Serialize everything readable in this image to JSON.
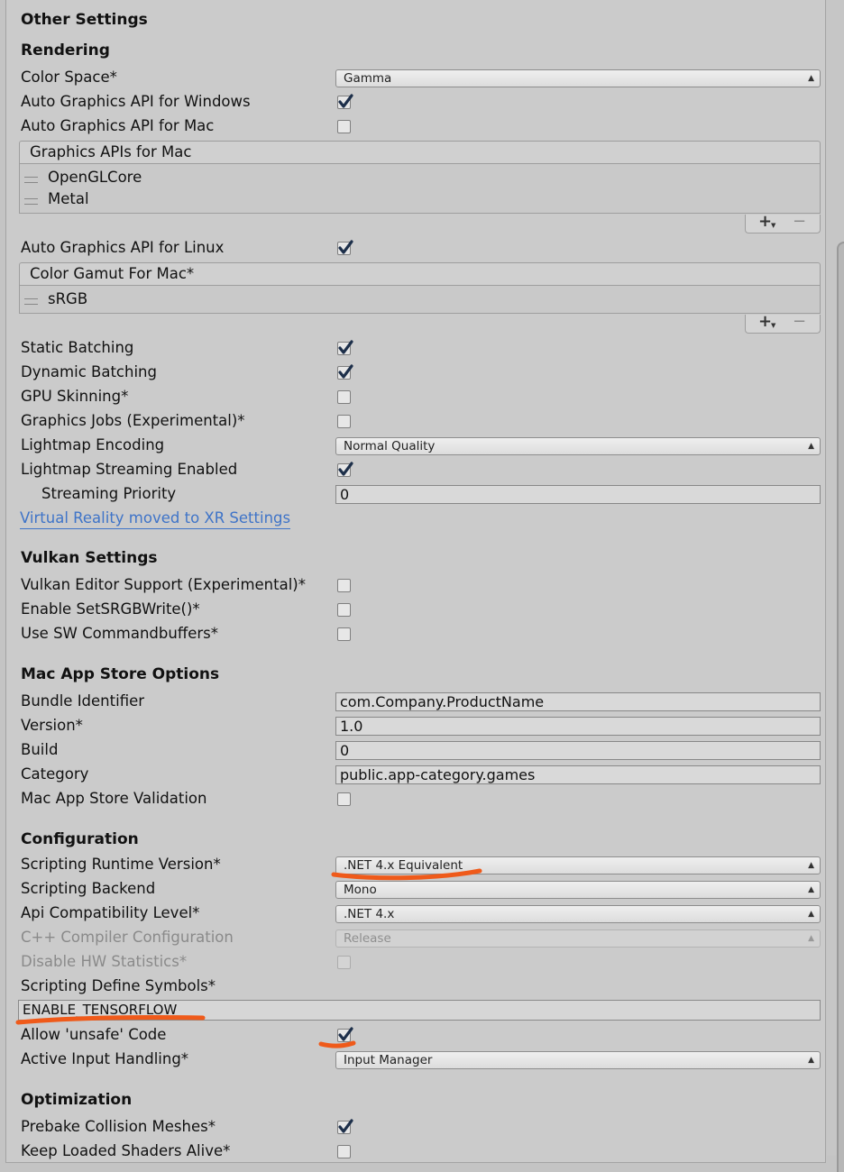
{
  "header": {
    "title": "Other Settings"
  },
  "rendering": {
    "title": "Rendering",
    "color_space": {
      "label": "Color Space*",
      "value": "Gamma"
    },
    "auto_api_windows": {
      "label": "Auto Graphics API  for Windows",
      "checked": true
    },
    "auto_api_mac": {
      "label": "Auto Graphics API  for Mac",
      "checked": false
    },
    "graphics_apis_mac": {
      "header": "Graphics APIs for Mac",
      "items": [
        "OpenGLCore",
        "Metal"
      ]
    },
    "auto_api_linux": {
      "label": "Auto Graphics API  for Linux",
      "checked": true
    },
    "color_gamut_mac": {
      "header": "Color Gamut For Mac*",
      "items": [
        "sRGB"
      ]
    },
    "static_batching": {
      "label": "Static Batching",
      "checked": true
    },
    "dynamic_batching": {
      "label": "Dynamic Batching",
      "checked": true
    },
    "gpu_skinning": {
      "label": "GPU Skinning*",
      "checked": false
    },
    "graphics_jobs": {
      "label": "Graphics Jobs (Experimental)*",
      "checked": false
    },
    "lightmap_encoding": {
      "label": "Lightmap Encoding",
      "value": "Normal Quality"
    },
    "lightmap_streaming": {
      "label": "Lightmap Streaming Enabled",
      "checked": true
    },
    "streaming_priority": {
      "label": "Streaming Priority",
      "value": "0"
    },
    "vr_link": "Virtual Reality moved to XR Settings"
  },
  "vulkan": {
    "title": "Vulkan Settings",
    "editor_support": {
      "label": "Vulkan Editor Support (Experimental)*",
      "checked": false
    },
    "set_srgb_write": {
      "label": "Enable SetSRGBWrite()*",
      "checked": false
    },
    "sw_commandbuffers": {
      "label": "Use SW Commandbuffers*",
      "checked": false
    }
  },
  "mac_app_store": {
    "title": "Mac App Store Options",
    "bundle_identifier": {
      "label": "Bundle Identifier",
      "value": "com.Company.ProductName"
    },
    "version": {
      "label": "Version*",
      "value": "1.0"
    },
    "build": {
      "label": "Build",
      "value": "0"
    },
    "category": {
      "label": "Category",
      "value": "public.app-category.games"
    },
    "validation": {
      "label": "Mac App Store Validation",
      "checked": false
    }
  },
  "configuration": {
    "title": "Configuration",
    "scripting_runtime": {
      "label": "Scripting Runtime Version*",
      "value": ".NET 4.x Equivalent"
    },
    "scripting_backend": {
      "label": "Scripting Backend",
      "value": "Mono"
    },
    "api_compat": {
      "label": "Api Compatibility Level*",
      "value": ".NET 4.x"
    },
    "cpp_compiler": {
      "label": "C++ Compiler Configuration",
      "value": "Release"
    },
    "disable_hw_stats": {
      "label": "Disable HW Statistics*",
      "checked": false
    },
    "define_symbols": {
      "label": "Scripting Define Symbols*",
      "value": "ENABLE_TENSORFLOW"
    },
    "allow_unsafe": {
      "label": "Allow 'unsafe' Code",
      "checked": true
    },
    "input_handling": {
      "label": "Active Input Handling*",
      "value": "Input Manager"
    }
  },
  "optimization": {
    "title": "Optimization",
    "prebake_collision": {
      "label": "Prebake Collision Meshes*",
      "checked": true
    },
    "keep_shaders": {
      "label": "Keep Loaded Shaders Alive*",
      "checked": false
    }
  },
  "annotation_color": "#ef5a1a"
}
